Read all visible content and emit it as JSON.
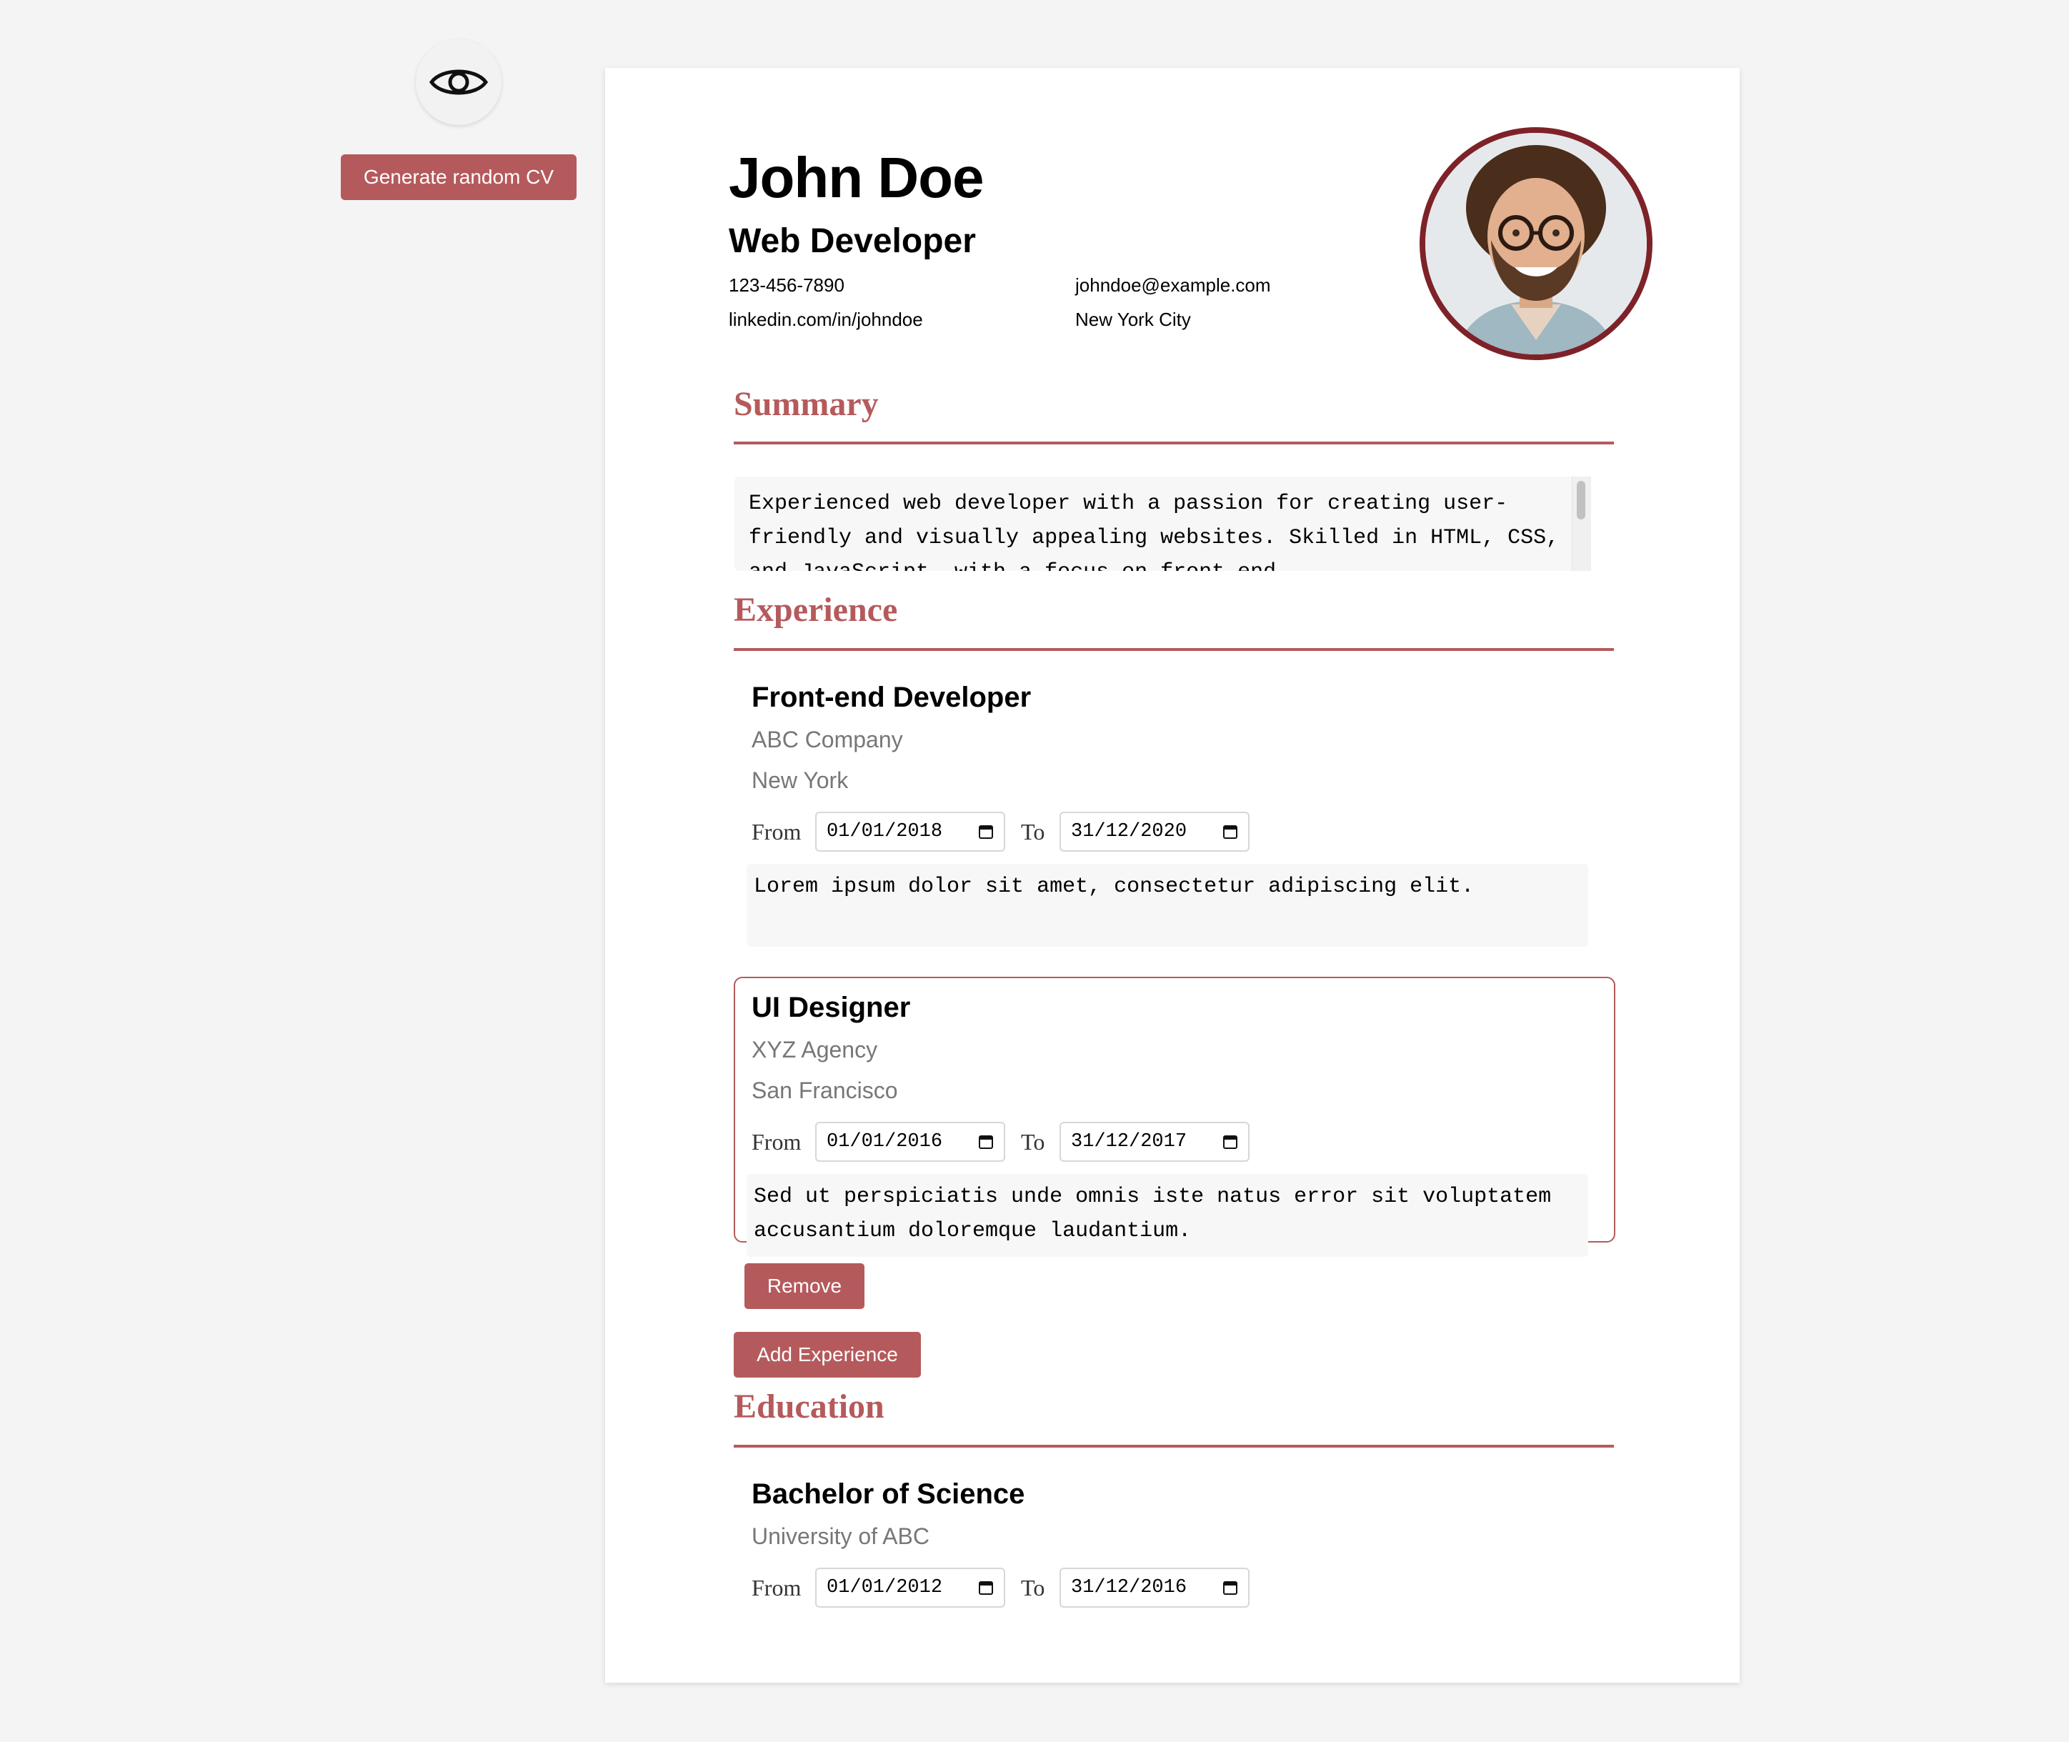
{
  "controls": {
    "preview_icon": "eye-icon",
    "generate_label": "Generate random CV"
  },
  "header": {
    "name": "John Doe",
    "role": "Web Developer",
    "phone": "123-456-7890",
    "email": "johndoe@example.com",
    "linkedin": "linkedin.com/in/johndoe",
    "location": "New York City"
  },
  "summary": {
    "title": "Summary",
    "text": "Experienced web developer with a passion for creating user-friendly and visually appealing websites. Skilled in HTML, CSS, and JavaScript, with a focus on front-end"
  },
  "experience": {
    "title": "Experience",
    "items": [
      {
        "title": "Front-end Developer",
        "company": "ABC Company",
        "location": "New York",
        "from_label": "From",
        "from": "01/01/2018",
        "to_label": "To",
        "to": "31/12/2020",
        "description": "Lorem ipsum dolor sit amet, consectetur adipiscing elit."
      },
      {
        "title": "UI Designer",
        "company": "XYZ Agency",
        "location": "San Francisco",
        "from_label": "From",
        "from": "01/01/2016",
        "to_label": "To",
        "to": "31/12/2017",
        "description": "Sed ut perspiciatis unde omnis iste natus error sit voluptatem accusantium doloremque laudantium.",
        "remove_label": "Remove"
      }
    ],
    "add_label": "Add Experience"
  },
  "education": {
    "title": "Education",
    "items": [
      {
        "degree": "Bachelor of Science",
        "school": "University of ABC",
        "from_label": "From",
        "from": "01/01/2012",
        "to_label": "To",
        "to": "31/12/2016"
      }
    ]
  },
  "colors": {
    "accent": "#b55a5c",
    "photo_border": "#7e2229",
    "background": "#f4f4f4"
  }
}
